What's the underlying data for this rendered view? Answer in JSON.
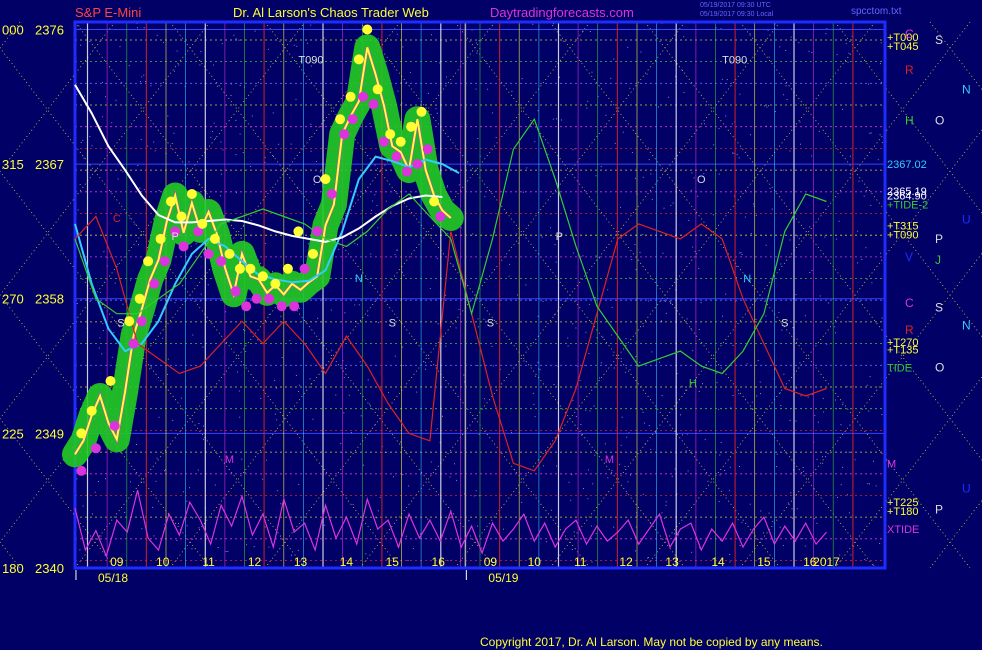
{
  "header": {
    "instrument": "S&P E-Mini",
    "site": "Dr. Al Larson's Chaos Trader Web",
    "url": "Daytradingforecasts.com",
    "stamp1": "05/19/2017 09:30 UTC",
    "stamp2": "05/19/2017 09:30 Local",
    "file": "spcctom.txt"
  },
  "footer": {
    "copyright": "Copyright 2017, Dr. Al Larson. May not be copied by any means."
  },
  "colors": {
    "background": "#000066",
    "frame": "#1f2cff",
    "price_line": "#ffff33",
    "average_cyan": "#33ccff",
    "average_white": "#ffffff",
    "forecast_red": "#dd2222",
    "forecast_green": "#33cc33",
    "cycle_magenta": "#dd33dd",
    "band_green": "#22cc22"
  },
  "chart_data": {
    "type": "line",
    "title": "S&P E-Mini",
    "ylim": [
      2340,
      2376.5
    ],
    "xlim": [
      0,
      19.4
    ],
    "y_ticks": [
      {
        "left": "000",
        "price": "2376",
        "value": 2376
      },
      {
        "left": "315",
        "price": "2367",
        "value": 2367
      },
      {
        "left": "270",
        "price": "2358",
        "value": 2358
      },
      {
        "left": "225",
        "price": "2349",
        "value": 2349
      },
      {
        "left": "180",
        "price": "2340",
        "value": 2340
      }
    ],
    "dates": [
      {
        "label": "05/18",
        "x": 0.55
      },
      {
        "label": "05/19",
        "x": 9.9
      }
    ],
    "x_ticks": [
      {
        "label": "09",
        "x": 1.0
      },
      {
        "label": "10",
        "x": 2.1
      },
      {
        "label": "11",
        "x": 3.2
      },
      {
        "label": "12",
        "x": 4.3
      },
      {
        "label": "13",
        "x": 5.4
      },
      {
        "label": "14",
        "x": 6.5
      },
      {
        "label": "15",
        "x": 7.6
      },
      {
        "label": "16",
        "x": 8.7
      },
      {
        "label": "09",
        "x": 9.95
      },
      {
        "label": "10",
        "x": 11.0
      },
      {
        "label": "11",
        "x": 12.1
      },
      {
        "label": "12",
        "x": 13.2
      },
      {
        "label": "13",
        "x": 14.3
      },
      {
        "label": "14",
        "x": 15.4
      },
      {
        "label": "15",
        "x": 16.5
      },
      {
        "label": "16",
        "x": 17.6
      },
      {
        "label": "2017",
        "x": 18.0
      }
    ],
    "right_levels": [
      {
        "text": "+T000",
        "value": 2375.5,
        "color": "#ffff33"
      },
      {
        "text": "+T045",
        "value": 2374.9,
        "color": "#ffff33"
      },
      {
        "text": "2367.02",
        "value": 2367.0,
        "color": "#33ccff"
      },
      {
        "text": "2365.19",
        "value": 2365.2,
        "color": "#ffffff"
      },
      {
        "text": "2364.90",
        "value": 2364.9,
        "color": "#ffffff"
      },
      {
        "text": "+TIDE-2",
        "value": 2364.3,
        "color": "#33cc33"
      },
      {
        "text": "+T315",
        "value": 2362.9,
        "color": "#ffff33"
      },
      {
        "text": "+T090",
        "value": 2362.3,
        "color": "#ffff33"
      },
      {
        "text": "+T270",
        "value": 2355.1,
        "color": "#ffff33"
      },
      {
        "text": "+T135",
        "value": 2354.6,
        "color": "#ffff33"
      },
      {
        "text": "TIDE",
        "value": 2353.4,
        "color": "#33cc33"
      },
      {
        "text": "M",
        "value": 2347.0,
        "color": "#dd33dd"
      },
      {
        "text": "+T225",
        "value": 2344.4,
        "color": "#ffff33"
      },
      {
        "text": "+T180",
        "value": 2343.8,
        "color": "#ffff33"
      },
      {
        "text": "XTIDE",
        "value": 2342.6,
        "color": "#dd33dd"
      }
    ],
    "series": [
      {
        "name": "",
        "color": "#ffff33",
        "x": [
          0.0,
          0.2,
          0.4,
          0.6,
          0.8,
          1.0,
          1.2,
          1.4,
          1.6,
          1.8,
          2.0,
          2.2,
          2.4,
          2.6,
          2.8,
          3.0,
          3.2,
          3.4,
          3.6,
          3.8,
          4.0,
          4.2,
          4.4,
          4.6,
          4.8,
          5.0,
          5.2,
          5.4,
          5.6,
          5.8,
          6.0,
          6.2,
          6.4,
          6.6,
          6.8,
          7.0,
          7.2,
          7.4,
          7.6,
          7.8,
          8.0,
          8.2,
          8.4,
          8.6,
          8.8,
          9.0
        ],
        "values": [
          2347.6,
          2348.5,
          2350.2,
          2351.5,
          2349.7,
          2348.6,
          2351.8,
          2355.5,
          2357.3,
          2359.3,
          2360.6,
          2363.2,
          2364.9,
          2362.4,
          2364.4,
          2362.6,
          2363.8,
          2362.3,
          2360.0,
          2358.3,
          2361.0,
          2359.5,
          2359.3,
          2358.4,
          2358.9,
          2358.3,
          2359.0,
          2358.6,
          2359.1,
          2359.5,
          2362.9,
          2364.3,
          2369.0,
          2370.2,
          2371.2,
          2374.8,
          2373.0,
          2370.9,
          2368.2,
          2367.8,
          2366.6,
          2370.0,
          2366.6,
          2364.9,
          2363.9,
          2363.4
        ]
      },
      {
        "name": "",
        "color": "#33ccff",
        "x": [
          0.0,
          0.4,
          0.8,
          1.2,
          1.6,
          2.0,
          2.4,
          2.8,
          3.2,
          3.6,
          4.0,
          4.4,
          4.8,
          5.2,
          5.6,
          6.0,
          6.4,
          6.8,
          7.2,
          7.6,
          8.0,
          8.4,
          8.8,
          9.2
        ],
        "values": [
          2363.0,
          2359.0,
          2356.0,
          2354.5,
          2355.0,
          2356.5,
          2359.0,
          2361.0,
          2362.0,
          2361.5,
          2360.5,
          2359.6,
          2359.3,
          2359.1,
          2359.2,
          2359.9,
          2362.5,
          2366.0,
          2367.5,
          2367.2,
          2366.8,
          2367.3,
          2367.0,
          2366.4
        ]
      },
      {
        "name": "",
        "color": "#ffffff",
        "x": [
          0.0,
          0.4,
          0.8,
          1.2,
          1.6,
          2.0,
          2.4,
          2.8,
          3.2,
          3.6,
          4.0,
          4.4,
          4.8,
          5.2,
          5.6,
          6.0,
          6.4,
          6.8,
          7.2,
          7.6,
          8.0,
          8.4,
          8.8
        ],
        "values": [
          2372.3,
          2370.4,
          2368.2,
          2366.6,
          2364.9,
          2363.6,
          2363.1,
          2363.1,
          2363.2,
          2363.3,
          2363.2,
          2362.9,
          2362.5,
          2362.2,
          2362.0,
          2361.8,
          2362.1,
          2362.7,
          2363.5,
          2364.2,
          2364.7,
          2364.9,
          2364.8
        ]
      },
      {
        "name": "",
        "color": "#dd2222",
        "x": [
          0.0,
          0.5,
          1.0,
          1.5,
          2.0,
          2.5,
          3.0,
          3.5,
          4.0,
          4.5,
          5.0,
          5.5,
          6.0,
          6.5,
          7.0,
          7.5,
          8.0,
          8.5,
          9.0,
          9.5,
          10.0,
          10.5,
          11.0,
          11.5,
          12.0,
          12.5,
          13.0,
          13.5,
          14.0,
          14.5,
          15.0,
          15.5,
          16.0,
          16.5,
          17.0,
          17.5,
          18.0
        ],
        "values": [
          2362.0,
          2363.5,
          2360.0,
          2355.0,
          2354.0,
          2353.0,
          2353.5,
          2355.0,
          2356.5,
          2355.0,
          2356.5,
          2355.0,
          2353.0,
          2355.5,
          2353.5,
          2351.0,
          2349.0,
          2348.5,
          2362.5,
          2357.0,
          2351.5,
          2347.0,
          2346.5,
          2348.5,
          2352.0,
          2357.0,
          2362.0,
          2363.0,
          2362.5,
          2362.0,
          2363.0,
          2362.0,
          2358.0,
          2355.0,
          2352.0,
          2351.5,
          2352.0
        ]
      },
      {
        "name": "",
        "color": "#33cc33",
        "x": [
          0.0,
          0.5,
          1.0,
          1.5,
          2.0,
          2.5,
          3.0,
          3.5,
          4.0,
          4.5,
          5.0,
          5.5,
          6.0,
          6.5,
          7.0,
          7.5,
          8.0,
          8.5,
          9.0,
          9.5,
          10.0,
          10.5,
          11.0,
          11.5,
          12.0,
          12.5,
          13.0,
          13.5,
          14.0,
          14.5,
          15.0,
          15.5,
          16.0,
          16.5,
          17.0,
          17.5,
          18.0
        ],
        "values": [
          2362.0,
          2358.0,
          2357.0,
          2357.0,
          2358.0,
          2359.0,
          2361.0,
          2363.0,
          2363.5,
          2364.0,
          2363.5,
          2363.0,
          2362.0,
          2361.5,
          2362.5,
          2364.0,
          2365.0,
          2363.5,
          2362.0,
          2357.0,
          2362.0,
          2368.0,
          2370.0,
          2366.0,
          2361.5,
          2357.5,
          2355.5,
          2353.5,
          2354.0,
          2354.5,
          2353.5,
          2353.0,
          2354.5,
          2357.0,
          2362.5,
          2365.0,
          2364.5
        ]
      },
      {
        "name": "",
        "color": "#dd33dd",
        "x": [
          0.0,
          0.25,
          0.5,
          0.75,
          1.0,
          1.25,
          1.5,
          1.75,
          2.0,
          2.25,
          2.5,
          2.75,
          3.0,
          3.25,
          3.5,
          3.75,
          4.0,
          4.25,
          4.5,
          4.75,
          5.0,
          5.25,
          5.5,
          5.75,
          6.0,
          6.25,
          6.5,
          6.75,
          7.0,
          7.25,
          7.5,
          7.75,
          8.0,
          8.25,
          8.5,
          8.75,
          9.0,
          9.25,
          9.5,
          9.75,
          10.0,
          10.25,
          10.5,
          10.75,
          11.0,
          11.25,
          11.5,
          11.75,
          12.0,
          12.25,
          12.5,
          12.75,
          13.0,
          13.25,
          13.5,
          13.75,
          14.0,
          14.25,
          14.5,
          14.75,
          15.0,
          15.25,
          15.5,
          15.75,
          16.0,
          16.25,
          16.5,
          16.75,
          17.0,
          17.25,
          17.5,
          17.75,
          18.0
        ],
        "values": [
          2344.0,
          2341.2,
          2342.5,
          2340.8,
          2343.2,
          2342.4,
          2345.2,
          2342.0,
          2341.2,
          2343.6,
          2342.2,
          2344.4,
          2343.2,
          2341.6,
          2344.2,
          2342.8,
          2344.8,
          2342.2,
          2343.6,
          2341.4,
          2344.6,
          2342.4,
          2343.0,
          2341.2,
          2344.2,
          2342.0,
          2343.4,
          2341.6,
          2344.6,
          2342.6,
          2343.2,
          2341.4,
          2343.6,
          2342.0,
          2343.2,
          2341.8,
          2343.8,
          2341.4,
          2342.8,
          2341.0,
          2343.0,
          2341.8,
          2342.6,
          2343.6,
          2341.8,
          2343.0,
          2341.4,
          2342.6,
          2343.2,
          2341.6,
          2342.8,
          2341.8,
          2342.4,
          2343.2,
          2341.6,
          2342.6,
          2343.6,
          2341.4,
          2342.6,
          2343.0,
          2341.2,
          2342.6,
          2341.8,
          2343.0,
          2341.4,
          2342.6,
          2343.4,
          2341.6,
          2342.8,
          2341.8,
          2343.0,
          2341.6,
          2342.4
        ]
      }
    ],
    "markers": {
      "yellow_x": [
        0.15,
        0.4,
        0.85,
        1.3,
        1.55,
        1.75,
        2.05,
        2.3,
        2.55,
        2.8,
        3.05,
        3.35,
        3.7,
        3.95,
        4.2,
        4.5,
        4.8,
        5.1,
        5.35,
        5.7,
        6.0,
        6.35,
        6.6,
        6.8,
        7.0,
        7.25,
        7.55,
        7.8,
        8.05,
        8.3,
        8.6
      ],
      "yellow_y": [
        2349.0,
        2350.5,
        2352.5,
        2356.5,
        2358.0,
        2360.5,
        2362.0,
        2364.5,
        2363.5,
        2365.0,
        2363.0,
        2362.0,
        2361.0,
        2360.0,
        2360.0,
        2359.5,
        2359.0,
        2360.0,
        2362.5,
        2361.0,
        2366.0,
        2370.0,
        2371.5,
        2374.0,
        2376.0,
        2372.0,
        2369.0,
        2368.5,
        2369.5,
        2370.5,
        2364.5
      ],
      "magenta_x": [
        0.15,
        0.5,
        0.95,
        1.4,
        1.6,
        1.9,
        2.15,
        2.4,
        2.6,
        2.95,
        3.2,
        3.5,
        3.85,
        4.1,
        4.35,
        4.65,
        4.95,
        5.25,
        5.5,
        5.8,
        6.15,
        6.45,
        6.65,
        6.9,
        7.15,
        7.4,
        7.7,
        7.95,
        8.2,
        8.45,
        8.75
      ],
      "magenta_y": [
        2346.5,
        2348.0,
        2349.5,
        2355.0,
        2356.5,
        2359.0,
        2360.5,
        2362.5,
        2361.5,
        2362.5,
        2361.0,
        2360.5,
        2358.5,
        2357.5,
        2358.0,
        2358.0,
        2357.5,
        2357.5,
        2360.0,
        2362.5,
        2365.0,
        2369.0,
        2370.0,
        2371.5,
        2371.0,
        2368.5,
        2367.5,
        2366.5,
        2367.0,
        2368.0,
        2363.5
      ]
    },
    "annotations": [
      {
        "text": "T090",
        "x": 5.65,
        "value": 2374.0,
        "color": "#dddddd"
      },
      {
        "text": "T090",
        "x": 15.8,
        "value": 2374.0,
        "color": "#dddddd"
      },
      {
        "text": "O",
        "x": 5.8,
        "value": 2366.0,
        "color": "#dddddd"
      },
      {
        "text": "O",
        "x": 15.0,
        "value": 2366.0,
        "color": "#dddddd"
      },
      {
        "text": "P",
        "x": 2.4,
        "value": 2362.2,
        "color": "#dddddd"
      },
      {
        "text": "P",
        "x": 11.6,
        "value": 2362.2,
        "color": "#dddddd"
      },
      {
        "text": "N",
        "x": 6.8,
        "value": 2359.4,
        "color": "#33ccff"
      },
      {
        "text": "N",
        "x": 16.1,
        "value": 2359.4,
        "color": "#33ccff"
      },
      {
        "text": "S",
        "x": 1.1,
        "value": 2356.4,
        "color": "#dddddd"
      },
      {
        "text": "S",
        "x": 7.6,
        "value": 2356.4,
        "color": "#dddddd"
      },
      {
        "text": "S",
        "x": 9.95,
        "value": 2356.4,
        "color": "#dddddd"
      },
      {
        "text": "S",
        "x": 17.0,
        "value": 2356.4,
        "color": "#dddddd"
      },
      {
        "text": "H",
        "x": 14.8,
        "value": 2352.4,
        "color": "#33cc33"
      },
      {
        "text": "M",
        "x": 3.7,
        "value": 2347.3,
        "color": "#dd33dd"
      },
      {
        "text": "M",
        "x": 12.8,
        "value": 2347.3,
        "color": "#dd33dd"
      },
      {
        "text": "C",
        "x": 1.0,
        "value": 2363.4,
        "color": "#dd2222"
      }
    ],
    "side_glyphs": [
      {
        "text": "C",
        "px_color": "#dd33dd",
        "value": 2375.7,
        "col": 0
      },
      {
        "text": "S",
        "px_color": "#dddddd",
        "value": 2375.3,
        "col": 1
      },
      {
        "text": "R",
        "px_color": "#dd2222",
        "value": 2373.3,
        "col": 0
      },
      {
        "text": "N",
        "px_color": "#33ccff",
        "value": 2372.0,
        "col": 2
      },
      {
        "text": "H",
        "px_color": "#33cc33",
        "value": 2369.9,
        "col": 0
      },
      {
        "text": "O",
        "px_color": "#dddddd",
        "value": 2369.9,
        "col": 1
      },
      {
        "text": "U",
        "px_color": "#1f2cff",
        "value": 2363.3,
        "col": 2
      },
      {
        "text": "P",
        "px_color": "#dddddd",
        "value": 2362.0,
        "col": 1
      },
      {
        "text": "V",
        "px_color": "#1f2cff",
        "value": 2360.8,
        "col": 0
      },
      {
        "text": "J",
        "px_color": "#33cc33",
        "value": 2360.6,
        "col": 1
      },
      {
        "text": "C",
        "px_color": "#dd33dd",
        "value": 2357.7,
        "col": 0
      },
      {
        "text": "S",
        "px_color": "#dddddd",
        "value": 2357.4,
        "col": 1
      },
      {
        "text": "R",
        "px_color": "#dd2222",
        "value": 2355.9,
        "col": 0
      },
      {
        "text": "N",
        "px_color": "#33ccff",
        "value": 2356.2,
        "col": 2
      },
      {
        "text": "O",
        "px_color": "#dddddd",
        "value": 2353.4,
        "col": 1
      },
      {
        "text": "U",
        "px_color": "#1f2cff",
        "value": 2345.3,
        "col": 2
      },
      {
        "text": "P",
        "px_color": "#dddddd",
        "value": 2343.9,
        "col": 1
      }
    ]
  }
}
